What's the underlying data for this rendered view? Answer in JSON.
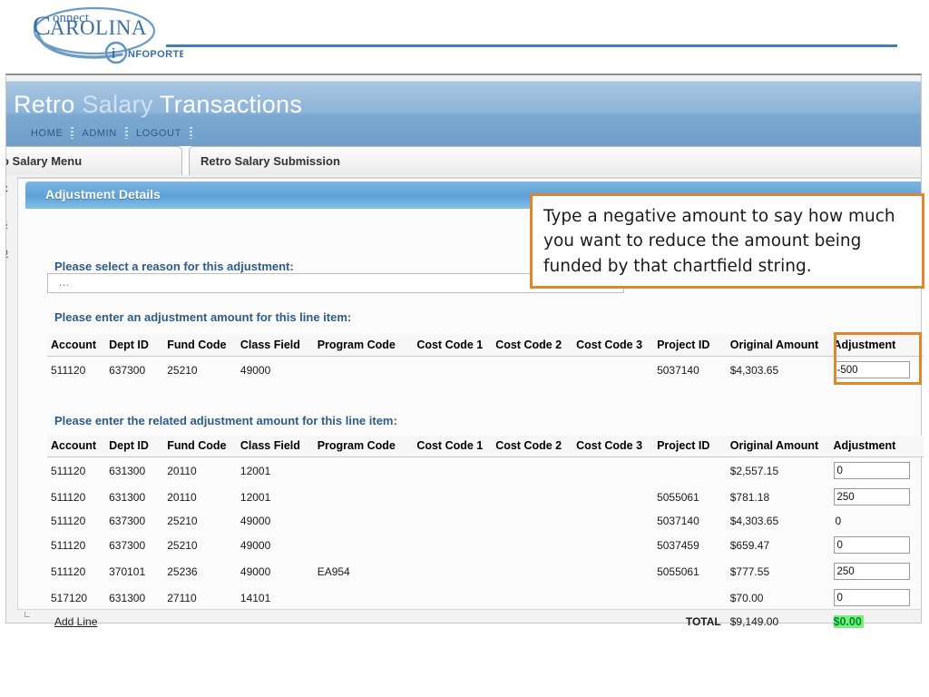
{
  "logo": {
    "word_top": "onnect",
    "word_main": "AROLINA",
    "initial_c": "C",
    "initial_c2": "C",
    "infoporte": "NFOPORTE",
    "infoporte_i": "i",
    "brand_color": "#4a80b5"
  },
  "app": {
    "title_part1": "Retro ",
    "title_part2": "Salary ",
    "title_part3": "Transactions",
    "title_full": "Retro Salary Transactions",
    "nav": [
      {
        "label": "HOME"
      },
      {
        "label": "ADMIN"
      },
      {
        "label": "LOGOUT"
      }
    ]
  },
  "tabs": [
    {
      "label": "o Salary Menu",
      "active": false
    },
    {
      "label": "Retro Salary Submission",
      "active": true
    }
  ],
  "panel": {
    "header": "Adjustment Details"
  },
  "edge_links": [
    {
      "label": "C"
    },
    {
      "label": "S"
    },
    {
      "label": "D"
    }
  ],
  "form": {
    "reason_label": "Please select a reason for this adjustment:",
    "reason_value": "...",
    "reason_placeholder": "...",
    "line_item_label": "Please enter an adjustment amount for this line item:",
    "related_label": "Please enter the related adjustment amount for this line item:",
    "add_line_label": "Add Line",
    "total_label": "TOTAL"
  },
  "columns": [
    "Account",
    "Dept ID",
    "Fund Code",
    "Class Field",
    "Program Code",
    "Cost Code 1",
    "Cost Code 2",
    "Cost Code 3",
    "Project ID",
    "Original Amount",
    "Adjustment"
  ],
  "line_item_table": {
    "rows": [
      {
        "account": "511120",
        "dept_id": "637300",
        "fund_code": "25210",
        "class_field": "49000",
        "program_code": "",
        "cost_code_1": "",
        "cost_code_2": "",
        "cost_code_3": "",
        "project_id": "5037140",
        "original_amount": "$4,303.65",
        "adjustment": "-500",
        "adjustment_is_input": true
      }
    ]
  },
  "related_table": {
    "rows": [
      {
        "account": "511120",
        "dept_id": "631300",
        "fund_code": "20110",
        "class_field": "12001",
        "program_code": "",
        "cost_code_1": "",
        "cost_code_2": "",
        "cost_code_3": "",
        "project_id": "",
        "original_amount": "$2,557.15",
        "adjustment": "0",
        "adjustment_is_input": true
      },
      {
        "account": "511120",
        "dept_id": "631300",
        "fund_code": "20110",
        "class_field": "12001",
        "program_code": "",
        "cost_code_1": "",
        "cost_code_2": "",
        "cost_code_3": "",
        "project_id": "5055061",
        "original_amount": "$781.18",
        "adjustment": "250",
        "adjustment_is_input": true
      },
      {
        "account": "511120",
        "dept_id": "637300",
        "fund_code": "25210",
        "class_field": "49000",
        "program_code": "",
        "cost_code_1": "",
        "cost_code_2": "",
        "cost_code_3": "",
        "project_id": "5037140",
        "original_amount": "$4,303.65",
        "adjustment": "0",
        "adjustment_is_input": false
      },
      {
        "account": "511120",
        "dept_id": "637300",
        "fund_code": "25210",
        "class_field": "49000",
        "program_code": "",
        "cost_code_1": "",
        "cost_code_2": "",
        "cost_code_3": "",
        "project_id": "5037459",
        "original_amount": "$659.47",
        "adjustment": "0",
        "adjustment_is_input": true
      },
      {
        "account": "511120",
        "dept_id": "370101",
        "fund_code": "25236",
        "class_field": "49000",
        "program_code": "EA954",
        "cost_code_1": "",
        "cost_code_2": "",
        "cost_code_3": "",
        "project_id": "5055061",
        "original_amount": "$777.55",
        "adjustment": "250",
        "adjustment_is_input": true
      },
      {
        "account": "517120",
        "dept_id": "631300",
        "fund_code": "27110",
        "class_field": "14101",
        "program_code": "",
        "cost_code_1": "",
        "cost_code_2": "",
        "cost_code_3": "",
        "project_id": "",
        "original_amount": "$70.00",
        "adjustment": "0",
        "adjustment_is_input": true
      }
    ],
    "total_original": "$9,149.00",
    "total_adjustment": "$0.00",
    "total_adjustment_color": "#008a2e",
    "total_adjustment_highlight": "#76f07a"
  },
  "callout": {
    "text": "Type a negative amount to say how much you want to reduce the amount being funded by that chartfield string.",
    "border_color": "#e2862b"
  },
  "highlight_box": {
    "border_color": "#e2862b"
  }
}
